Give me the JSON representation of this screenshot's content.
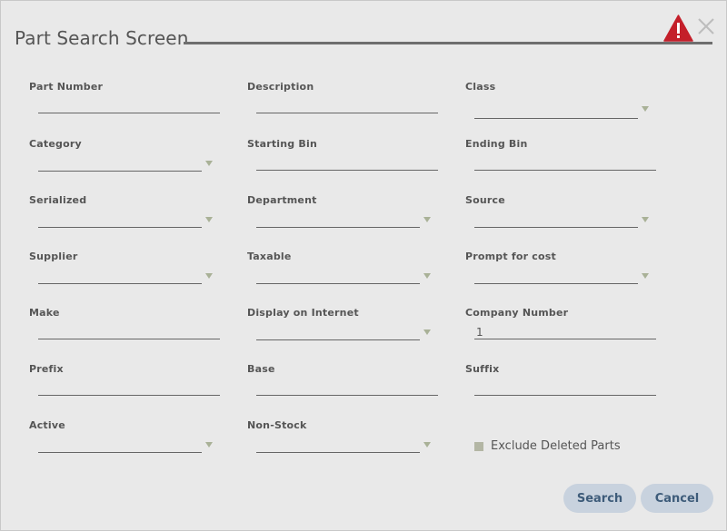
{
  "dialog": {
    "title": "Part Search Screen"
  },
  "icons": {
    "warning": "warning-icon",
    "close": "close-icon"
  },
  "colors": {
    "warning_red": "#c41f2a",
    "button_bg": "#c8d2de",
    "button_text": "#3e5c7a",
    "caret": "#a9b197"
  },
  "fields": {
    "part_number": {
      "label": "Part Number",
      "value": ""
    },
    "description": {
      "label": "Description",
      "value": ""
    },
    "class": {
      "label": "Class",
      "value": ""
    },
    "category": {
      "label": "Category",
      "value": ""
    },
    "starting_bin": {
      "label": "Starting Bin",
      "value": ""
    },
    "ending_bin": {
      "label": "Ending Bin",
      "value": ""
    },
    "serialized": {
      "label": "Serialized",
      "value": ""
    },
    "department": {
      "label": "Department",
      "value": ""
    },
    "source": {
      "label": "Source",
      "value": ""
    },
    "supplier": {
      "label": "Supplier",
      "value": ""
    },
    "taxable": {
      "label": "Taxable",
      "value": ""
    },
    "prompt_for_cost": {
      "label": "Prompt for cost",
      "value": ""
    },
    "make": {
      "label": "Make",
      "value": ""
    },
    "display_on_internet": {
      "label": "Display on Internet",
      "value": ""
    },
    "company_number": {
      "label": "Company Number",
      "value": "1"
    },
    "prefix": {
      "label": "Prefix",
      "value": ""
    },
    "base": {
      "label": "Base",
      "value": ""
    },
    "suffix": {
      "label": "Suffix",
      "value": ""
    },
    "active": {
      "label": "Active",
      "value": ""
    },
    "non_stock": {
      "label": "Non-Stock",
      "value": ""
    }
  },
  "exclude_deleted": {
    "label": "Exclude Deleted Parts",
    "checked": false
  },
  "buttons": {
    "search": "Search",
    "cancel": "Cancel"
  }
}
